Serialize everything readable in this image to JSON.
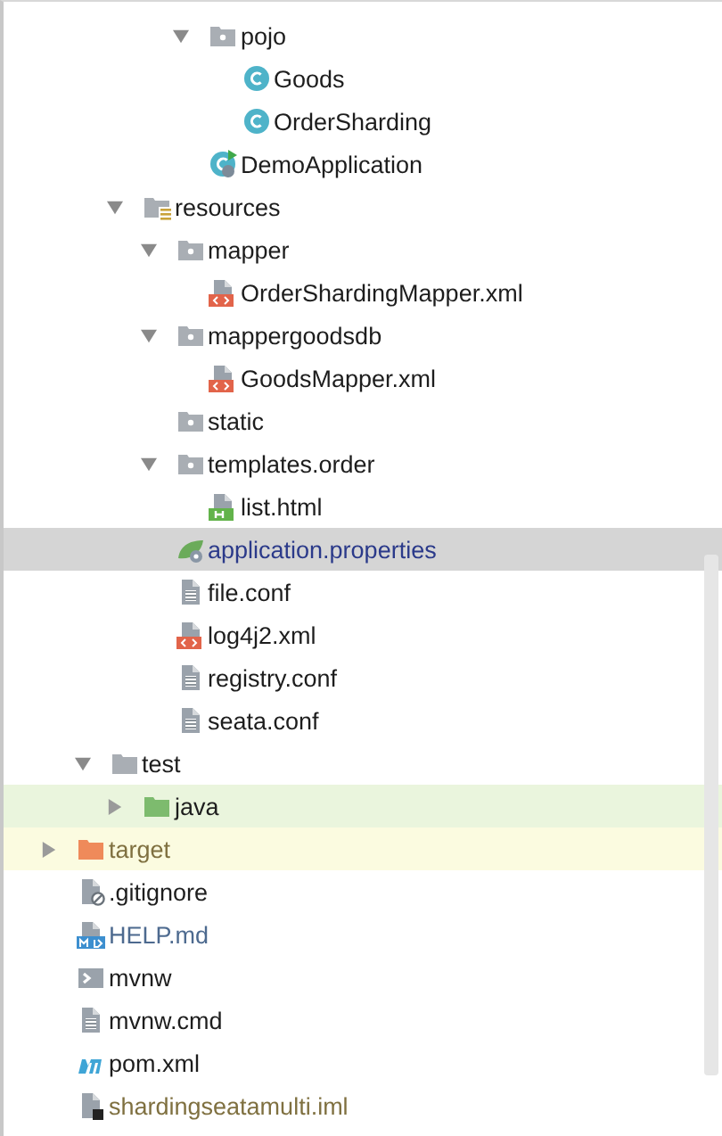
{
  "tree": [
    {
      "children": [
        {
          "children": [
            {
              "children": [
                {
                  "children": [
                    {
                      "label": "pojo",
                      "kind": "package",
                      "expanded": true,
                      "selected": false,
                      "children": [
                        {
                          "label": "Goods",
                          "kind": "class",
                          "selected": false
                        },
                        {
                          "label": "OrderSharding",
                          "kind": "class",
                          "selected": false
                        }
                      ]
                    },
                    {
                      "label": "DemoApplication",
                      "kind": "app-class",
                      "selected": false
                    }
                  ]
                }
              ]
            },
            {
              "label": "resources",
              "kind": "resources",
              "expanded": true,
              "selected": false,
              "children": [
                {
                  "label": "mapper",
                  "kind": "package",
                  "expanded": true,
                  "selected": false,
                  "children": [
                    {
                      "label": "OrderShardingMapper.xml",
                      "kind": "xml",
                      "selected": false
                    }
                  ]
                },
                {
                  "label": "mappergoodsdb",
                  "kind": "package",
                  "expanded": true,
                  "selected": false,
                  "children": [
                    {
                      "label": "GoodsMapper.xml",
                      "kind": "xml",
                      "selected": false
                    }
                  ]
                },
                {
                  "label": "static",
                  "kind": "package",
                  "selected": false
                },
                {
                  "label": "templates.order",
                  "kind": "package",
                  "expanded": true,
                  "selected": false,
                  "children": [
                    {
                      "label": "list.html",
                      "kind": "html",
                      "selected": false
                    }
                  ]
                },
                {
                  "label": "application.properties",
                  "kind": "properties",
                  "selected": true,
                  "color": "#2b3a8a"
                },
                {
                  "label": "file.conf",
                  "kind": "text",
                  "selected": false
                },
                {
                  "label": "log4j2.xml",
                  "kind": "xml",
                  "selected": false
                },
                {
                  "label": "registry.conf",
                  "kind": "text",
                  "selected": false
                },
                {
                  "label": "seata.conf",
                  "kind": "text",
                  "selected": false
                }
              ]
            }
          ]
        },
        {
          "label": "test",
          "kind": "folder",
          "expanded": true,
          "selected": false,
          "children": [
            {
              "label": "java",
              "kind": "test-folder",
              "expanded": false,
              "selected": false
            }
          ]
        }
      ]
    },
    {
      "label": "target",
      "kind": "excluded-folder",
      "expanded": false,
      "selected": false,
      "color": "#7f7040"
    },
    {
      "label": ".gitignore",
      "kind": "ignore",
      "selected": false
    },
    {
      "label": "HELP.md",
      "kind": "markdown",
      "selected": false,
      "color": "#4d6a8f"
    },
    {
      "label": "mvnw",
      "kind": "shell",
      "selected": false
    },
    {
      "label": "mvnw.cmd",
      "kind": "text",
      "selected": false
    },
    {
      "label": "pom.xml",
      "kind": "maven",
      "selected": false
    },
    {
      "label": "shardingseatamulti.iml",
      "kind": "iml",
      "selected": false,
      "color": "#7f7040"
    }
  ]
}
